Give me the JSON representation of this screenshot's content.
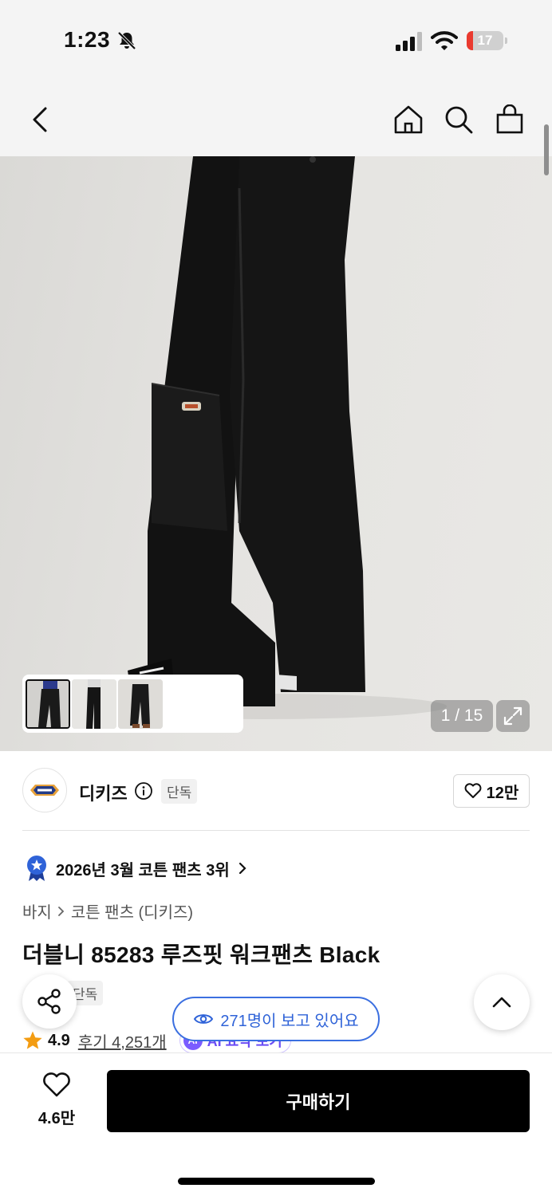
{
  "status_bar": {
    "time": "1:23",
    "battery": "17",
    "battery_level": 0.17
  },
  "product": {
    "image_counter": "1 / 15",
    "brand": {
      "name": "디키즈",
      "tag": "단독",
      "likes": "12만"
    },
    "ranking": "2026년 3월 코튼 팬츠 3위",
    "breadcrumb": [
      "바지",
      "코튼 팬츠 (디키즈)"
    ],
    "title": "더블니 85283 루즈핏 워크팬츠 Black",
    "title_tag": "단독",
    "rating": "4.9",
    "reviews": "후기 4,251개",
    "ai_chip": "AI 요약 보기"
  },
  "floating": {
    "viewers": "271명이 보고 있어요"
  },
  "bottom_bar": {
    "wish_count": "4.6만",
    "buy_label": "구매하기"
  },
  "colors": {
    "accent_blue": "#2f63d8",
    "buy_button": "#000000",
    "battery_red": "#ea3a2f",
    "star": "#f39c12"
  }
}
